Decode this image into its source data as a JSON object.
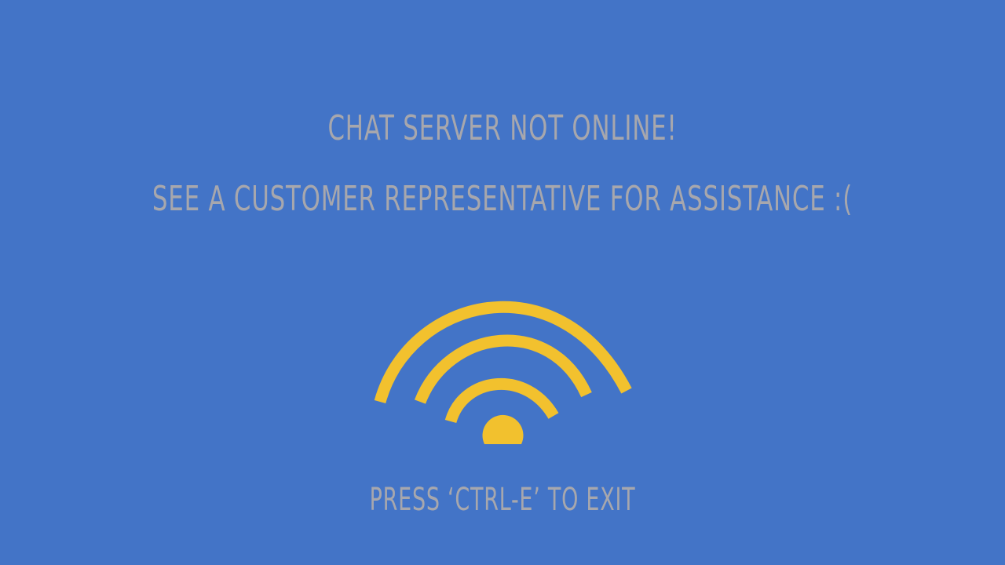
{
  "message": {
    "title": "Chat Server not online!",
    "subtitle": "See a customer representative for assistance :("
  },
  "icon": {
    "name": "wifi-signal-icon",
    "color": "#f2c12e"
  },
  "hint": {
    "text": "Press ‘Ctrl-E’ to exit"
  },
  "colors": {
    "background": "#4374c7",
    "text": "#a7a7ad"
  }
}
